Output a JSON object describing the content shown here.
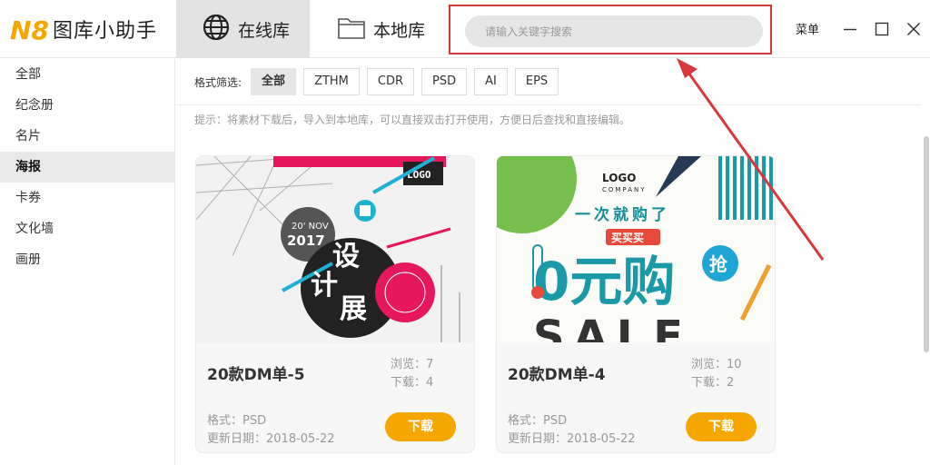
{
  "app": {
    "logo_mark": "N8",
    "name": "图库小助手"
  },
  "tabs": [
    {
      "label": "在线库",
      "icon": "globe-icon",
      "active": true
    },
    {
      "label": "本地库",
      "icon": "folder-icon",
      "active": false
    }
  ],
  "search": {
    "placeholder": "请输入关键字搜索"
  },
  "window": {
    "menu_label": "菜单"
  },
  "sidebar": {
    "items": [
      {
        "label": "全部",
        "active": false
      },
      {
        "label": "纪念册",
        "active": false
      },
      {
        "label": "名片",
        "active": false
      },
      {
        "label": "海报",
        "active": true
      },
      {
        "label": "卡券",
        "active": false
      },
      {
        "label": "文化墙",
        "active": false
      },
      {
        "label": "画册",
        "active": false
      }
    ]
  },
  "filter": {
    "title": "格式筛选:",
    "options": [
      {
        "label": "全部",
        "active": true
      },
      {
        "label": "ZTHM",
        "active": false
      },
      {
        "label": "CDR",
        "active": false
      },
      {
        "label": "PSD",
        "active": false
      },
      {
        "label": "AI",
        "active": false
      },
      {
        "label": "EPS",
        "active": false
      }
    ]
  },
  "tip": "提示：将素材下载后，导入到本地库，可以直接双击打开使用，方便日后查找和直接编辑。",
  "cards": [
    {
      "title": "20款DM单-5",
      "views_label": "浏览：7",
      "downloads_label": "下载：4",
      "format_label": "格式：PSD",
      "date_label": "更新日期：2018-05-22",
      "download_button": "下载",
      "thumb": {
        "date": "20' NOV",
        "year": "2017",
        "logo": "LOGO",
        "chars": [
          "设",
          "计",
          "展"
        ]
      }
    },
    {
      "title": "20款DM单-4",
      "views_label": "浏览：10",
      "downloads_label": "下载：2",
      "format_label": "格式：PSD",
      "date_label": "更新日期：2018-05-22",
      "download_button": "下载",
      "thumb": {
        "logo": "LOGO",
        "company": "COMPANY",
        "headline": "一次就购了",
        "badge": "买买买",
        "big": "0元购",
        "round": "抢",
        "sale": "SALE"
      }
    }
  ],
  "colors": {
    "accent": "#f5a700",
    "highlight_box": "#d9383a",
    "active_tab": "#e3e3e3",
    "logo_orange": "#f5a700"
  }
}
